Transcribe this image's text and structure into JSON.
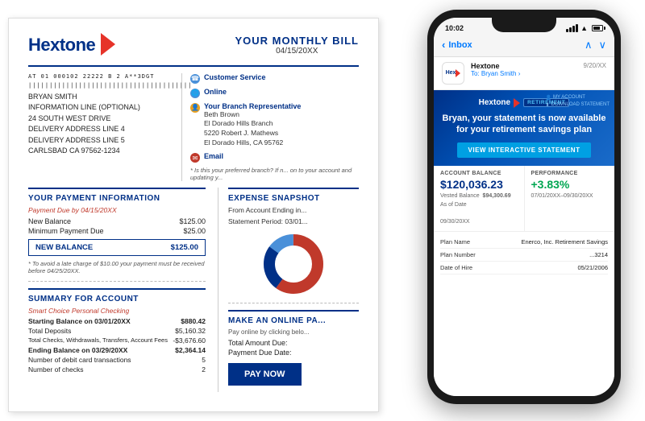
{
  "bill": {
    "logo_text": "Hextone",
    "title": "YOUR MONTHLY BILL",
    "date": "04/15/20XX",
    "contact": {
      "customer_service_label": "Customer Service",
      "online_label": "Online",
      "branch_label": "Your Branch Representative",
      "rep_name": "Beth Brown",
      "branch_name": "El Dorado Hills Branch",
      "branch_address1": "5220 Robert J. Mathews",
      "branch_address2": "El Dorado Hills, CA  95762",
      "email_label": "Email",
      "email_note": "* Is this your preferred branch? If n... on to your account and updating y..."
    },
    "address": {
      "barcode_id": "AT 01 000102 22222 B 2 A**3DGT",
      "name": "BRYAN SMITH",
      "line1": "INFORMATION LINE (OPTIONAL)",
      "line2": "24 SOUTH WEST DRIVE",
      "line3": "DELIVERY ADDRESS LINE 4",
      "line4": "DELIVERY ADDRESS LINE 5",
      "line5": "CARLSBAD  CA 97562-1234"
    },
    "payment": {
      "section_title": "YOUR PAYMENT INFORMATION",
      "due_label": "Payment Due by 04/15/20XX",
      "new_balance_label": "New Balance",
      "new_balance_amount": "$125.00",
      "min_payment_label": "Minimum Payment Due",
      "min_payment_amount": "$25.00",
      "new_balance_box_label": "NEW BALANCE",
      "new_balance_box_amount": "$125.00",
      "late_fee_note": "* To avoid a late charge of $10.00 your payment must be received before 04/25/20XX."
    },
    "expense_snapshot": {
      "section_title": "EXPENSE SNAPSHOT",
      "from_account": "From Account Ending in...",
      "statement_period": "Statement Period: 03/01..."
    },
    "online_pay": {
      "section_title": "MAKE AN ONLINE PA...",
      "sub_text": "Pay online by clicking belo...",
      "total_amount_label": "Total Amount Due:",
      "total_amount_val": "",
      "payment_due_label": "Payment Due Date:",
      "payment_due_val": "",
      "button_label": "PAY NOW"
    },
    "summary": {
      "section_title": "SUMMARY FOR ACCOUNT",
      "sub_label": "Smart Choice Personal Checking",
      "rows": [
        {
          "label": "Starting Balance on 03/01/20XX",
          "value": "$880.42"
        },
        {
          "label": "Total Deposits",
          "value": "$5,160.32"
        },
        {
          "label": "Total Checks, Withdrawals, Transfers, Account Fees",
          "value": "-$3,676.60"
        },
        {
          "label": "Ending Balance on 03/29/20XX",
          "value": "$2,364.14"
        },
        {
          "label": "Number of debit card transactions",
          "value": "5"
        },
        {
          "label": "Number of checks",
          "value": "2"
        }
      ]
    }
  },
  "phone": {
    "status_bar": {
      "time": "10:02"
    },
    "mail": {
      "inbox_label": "Inbox",
      "sender": "Hextone",
      "recipient": "To: Bryan Smith ›",
      "date": "9/20/XX",
      "retirement_badge": "RETIREMENT",
      "my_account_label": "MY ACCOUNT",
      "download_label": "DOWNLOAD STATEMENT",
      "banner_title": "Bryan, your statement is now available for your retirement savings plan",
      "view_statement_btn": "VIEW INTERACTIVE STATEMENT",
      "account_balance_label": "ACCOUNT BALANCE",
      "account_balance_value": "$120,036.23",
      "vested_balance_label": "Vested Balance",
      "vested_balance_value": "$94,300.69",
      "as_of_date_label": "As of Date",
      "as_of_date_value": "09/30/20XX",
      "performance_label": "PERFORMANCE",
      "performance_value": "+3.83%",
      "perf_period": "07/01/20XX–09/30/20XX",
      "plan_rows": [
        {
          "label": "Plan Name",
          "value": "Enerco, Inc. Retirement Savings"
        },
        {
          "label": "Plan Number",
          "value": "...3214"
        },
        {
          "label": "Date of Hire",
          "value": "05/21/2006"
        }
      ]
    }
  }
}
